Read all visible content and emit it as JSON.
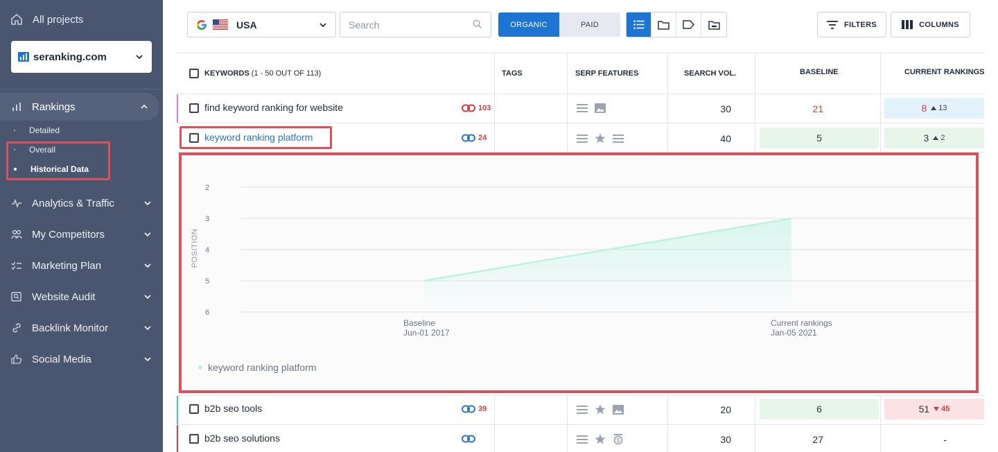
{
  "sidebar": {
    "all_projects": "All projects",
    "project": "seranking.com",
    "rankings": "Rankings",
    "sub_items": [
      "Detailed",
      "Overall",
      "Historical Data"
    ],
    "items": [
      {
        "label": "Analytics & Traffic",
        "icon": "pulse-icon"
      },
      {
        "label": "My Competitors",
        "icon": "people-icon"
      },
      {
        "label": "Marketing Plan",
        "icon": "checklist-icon"
      },
      {
        "label": "Website Audit",
        "icon": "audit-icon"
      },
      {
        "label": "Backlink Monitor",
        "icon": "link-icon"
      },
      {
        "label": "Social Media",
        "icon": "thumbs-up-icon"
      }
    ]
  },
  "toolbar": {
    "country": "USA",
    "search_placeholder": "Search",
    "organic": "ORGANIC",
    "paid": "PAID",
    "filters": "FILTERS",
    "columns": "COLUMNS"
  },
  "table": {
    "headers": {
      "keywords": "KEYWORDS",
      "keywords_count": "(1 - 50 OUT OF 113)",
      "tags": "TAGS",
      "serp": "SERP FEATURES",
      "volume": "SEARCH VOL.",
      "baseline": "BASELINE",
      "current": "CURRENT RANKINGS"
    },
    "rows": [
      {
        "keyword": "find keyword ranking for website",
        "backlinks": "103",
        "volume": "30",
        "baseline": "21",
        "current": "8",
        "change": "13"
      },
      {
        "keyword": "keyword ranking platform",
        "backlinks": "24",
        "volume": "40",
        "baseline": "5",
        "current": "3",
        "change": "2"
      },
      {
        "keyword": "b2b seo tools",
        "backlinks": "39",
        "volume": "20",
        "baseline": "6",
        "current": "51",
        "change": "45"
      },
      {
        "keyword": "b2b seo solutions",
        "backlinks": "",
        "volume": "30",
        "baseline": "27",
        "current": "-",
        "change": ""
      }
    ]
  },
  "chart_data": {
    "type": "line",
    "ylabel": "POSITION",
    "y_ticks": [
      "2",
      "3",
      "4",
      "5",
      "6"
    ],
    "ylim": [
      2,
      6
    ],
    "inverted_y": true,
    "categories": [
      {
        "label": "Baseline",
        "date": "Jun-01 2017"
      },
      {
        "label": "Current rankings",
        "date": "Jan-05 2021"
      }
    ],
    "series": [
      {
        "name": "keyword ranking platform",
        "values": [
          5,
          3
        ],
        "color": "#bdf1e0"
      }
    ]
  },
  "colors": {
    "sidebar_bg": "#4a5670",
    "accent": "#1d74d2",
    "highlight": "#d9515a",
    "green_cell": "#e8f6ea",
    "blue_cell": "#e3f1fb",
    "red_cell": "#fbe3e3"
  }
}
